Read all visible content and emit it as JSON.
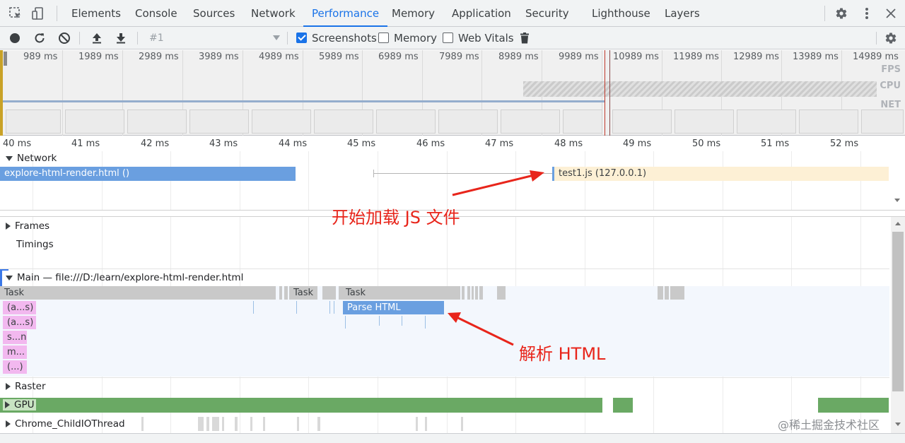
{
  "tabs": [
    "Elements",
    "Console",
    "Sources",
    "Network",
    "Performance",
    "Memory",
    "Application",
    "Security",
    "Lighthouse",
    "Layers"
  ],
  "active_tab": "Performance",
  "toolbar": {
    "profile_select": "#1",
    "screenshots_label": "Screenshots",
    "screenshots_checked": true,
    "memory_label": "Memory",
    "memory_checked": false,
    "webvitals_label": "Web Vitals",
    "webvitals_checked": false
  },
  "overview": {
    "ticks": [
      "989 ms",
      "1989 ms",
      "2989 ms",
      "3989 ms",
      "4989 ms",
      "5989 ms",
      "6989 ms",
      "7989 ms",
      "8989 ms",
      "9989 ms",
      "10989 ms",
      "11989 ms",
      "12989 ms",
      "13989 ms",
      "14989 ms"
    ],
    "fps_label": "FPS",
    "cpu_label": "CPU",
    "net_label": "NET"
  },
  "ruler": {
    "ticks": [
      "40 ms",
      "41 ms",
      "42 ms",
      "43 ms",
      "44 ms",
      "45 ms",
      "46 ms",
      "47 ms",
      "48 ms",
      "49 ms",
      "50 ms",
      "51 ms",
      "52 ms"
    ]
  },
  "network": {
    "label": "Network",
    "html_request": "explore-html-render.html ()",
    "js_request": "test1.js (127.0.0.1)"
  },
  "tracks": {
    "frames": "Frames",
    "timings": "Timings",
    "main": "Main — file:///D:/learn/explore-html-render.html",
    "raster": "Raster",
    "gpu": "GPU",
    "io_thread": "Chrome_ChildIOThread"
  },
  "flame": {
    "task1": "Task",
    "task2": "Task",
    "task3": "Task",
    "parse_html": "Parse HTML",
    "pink": [
      "(a...s)",
      "(a...s)",
      "s...n",
      "m...",
      "(...)"
    ]
  },
  "annotations": {
    "js_load": "开始加载 JS 文件",
    "parse_html": "解析 HTML"
  },
  "watermark": "@稀土掘金技术社区",
  "colors": {
    "accent": "#1a73e8",
    "network_html": "#6a9fe0",
    "network_js": "#fdf0d5",
    "parse_html": "#6a9fe0",
    "gpu": "#6aa964",
    "annotation": "#e8251b"
  }
}
